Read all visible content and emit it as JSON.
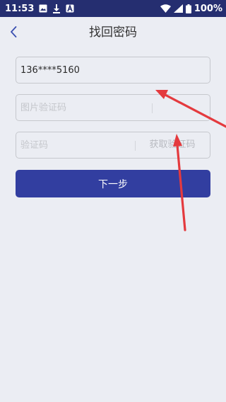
{
  "status_bar": {
    "time": "11:53",
    "battery": "100%",
    "left_icons": [
      "image-icon",
      "download-icon",
      "app-a-icon"
    ],
    "right_icons": [
      "wifi-icon",
      "signal-icon",
      "battery-icon"
    ]
  },
  "header": {
    "back_icon": "chevron-left-icon",
    "title": "找回密码"
  },
  "form": {
    "phone": {
      "value": "136****5160"
    },
    "image_captcha": {
      "placeholder": "图片验证码"
    },
    "sms_code": {
      "placeholder": "验证码",
      "get_code_label": "获取验证码"
    },
    "next_label": "下一步"
  },
  "colors": {
    "status_bar": "#252e70",
    "background": "#ebedf3",
    "accent": "#323ea0",
    "annotation_arrow": "#e43a3e",
    "back_icon": "#3a4fb0"
  }
}
